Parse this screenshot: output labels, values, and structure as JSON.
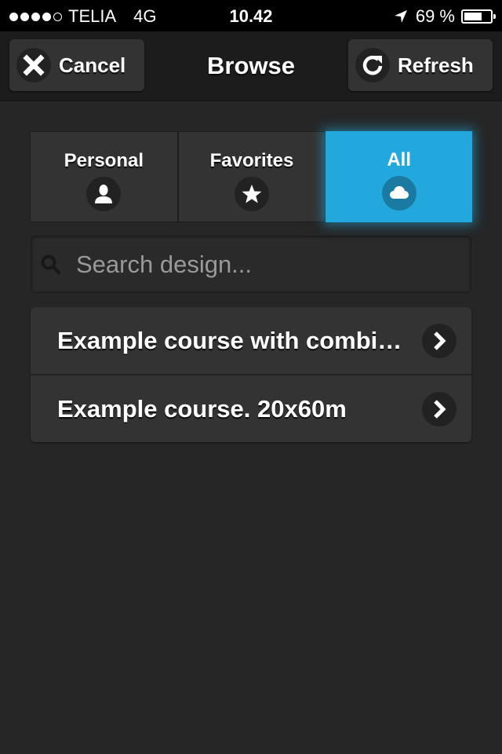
{
  "status_bar": {
    "signal_filled": 4,
    "signal_total": 5,
    "carrier": "TELIA",
    "network": "4G",
    "time": "10.42",
    "battery_percent_label": "69 %",
    "battery_level": 0.69
  },
  "nav": {
    "title": "Browse",
    "cancel_label": "Cancel",
    "refresh_label": "Refresh"
  },
  "tabs": [
    {
      "label": "Personal",
      "icon": "person-icon",
      "active": false
    },
    {
      "label": "Favorites",
      "icon": "star-icon",
      "active": false
    },
    {
      "label": "All",
      "icon": "cloud-icon",
      "active": true
    }
  ],
  "search": {
    "placeholder": "Search design...",
    "value": ""
  },
  "courses": [
    {
      "label": "Example course with combined..."
    },
    {
      "label": "Example course. 20x60m"
    }
  ],
  "colors": {
    "accent": "#22a8dc",
    "background": "#262626",
    "button": "#333333"
  }
}
